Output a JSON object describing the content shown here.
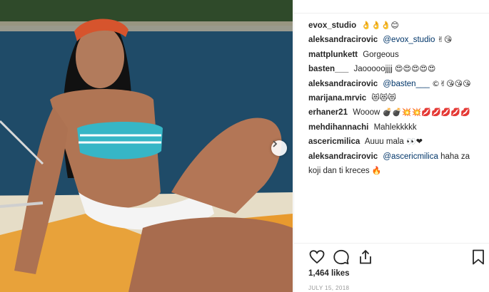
{
  "post": {
    "comments": [
      {
        "user": "evox_studio",
        "mention": "",
        "text": "",
        "emoji": "👌👌👌😊"
      },
      {
        "user": "aleksandracirovic",
        "mention": "@evox_studio",
        "text": "",
        "emoji": "✌😘"
      },
      {
        "user": "mattplunkett",
        "mention": "",
        "text": "Gorgeous",
        "emoji": ""
      },
      {
        "user": "basten___",
        "mention": "",
        "text": "Jaooooojjjj",
        "emoji": "😍😍😍😍😍"
      },
      {
        "user": "aleksandracirovic",
        "mention": "@basten___",
        "text": "",
        "emoji": "©✌😘😘😘"
      },
      {
        "user": "marijana.mrvic",
        "mention": "",
        "text": "",
        "emoji": "😻😻😻"
      },
      {
        "user": "erhaner21",
        "mention": "",
        "text": "Wooow",
        "emoji": "💣💣💥💥💋💋💋💋💋"
      },
      {
        "user": "mehdihannachi",
        "mention": "",
        "text": "Mahlekkkkk",
        "emoji": ""
      },
      {
        "user": "ascericmilica",
        "mention": "",
        "text": "Auuu mala",
        "emoji": "👀❤"
      },
      {
        "user": "aleksandracirovic",
        "mention": "@ascericmilica",
        "text": "haha za koji dan ti kreces",
        "emoji": "🔥"
      }
    ],
    "icons": {
      "like": "heart-icon",
      "comment": "comment-bubble-icon",
      "share": "share-icon",
      "save": "bookmark-icon",
      "next": "chevron-right-icon"
    },
    "likes": "1,464 likes",
    "date": "JULY 15, 2018"
  }
}
